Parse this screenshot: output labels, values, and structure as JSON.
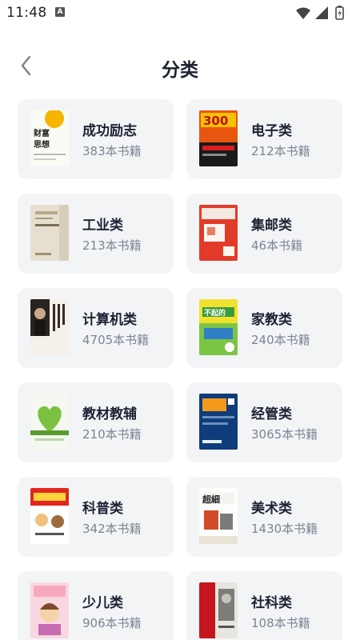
{
  "status": {
    "time": "11:48",
    "indicator": "A"
  },
  "header": {
    "title": "分类",
    "back_icon": "chevron-left-icon"
  },
  "categories": [
    {
      "name": "成功励志",
      "count": "383本书籍",
      "cover_theme": "white-yellow"
    },
    {
      "name": "电子类",
      "count": "212本书籍",
      "cover_theme": "orange-black"
    },
    {
      "name": "工业类",
      "count": "213本书籍",
      "cover_theme": "beige"
    },
    {
      "name": "集邮类",
      "count": "46本书籍",
      "cover_theme": "red-white"
    },
    {
      "name": "计算机类",
      "count": "4705本书籍",
      "cover_theme": "portrait"
    },
    {
      "name": "家教类",
      "count": "240本书籍",
      "cover_theme": "yellow-green"
    },
    {
      "name": "教材教辅",
      "count": "210本书籍",
      "cover_theme": "green-heart"
    },
    {
      "name": "经管类",
      "count": "3065本书籍",
      "cover_theme": "navy-orange"
    },
    {
      "name": "科普类",
      "count": "342本书籍",
      "cover_theme": "red-cartoon"
    },
    {
      "name": "美术类",
      "count": "1430本书籍",
      "cover_theme": "white-sketch"
    },
    {
      "name": "少儿类",
      "count": "906本书籍",
      "cover_theme": "pink-anime"
    },
    {
      "name": "社科类",
      "count": "108本书籍",
      "cover_theme": "grey-red"
    }
  ],
  "colors": {
    "card_bg": "#f3f4f6",
    "title": "#1c2233",
    "count_text": "#7d8393"
  }
}
